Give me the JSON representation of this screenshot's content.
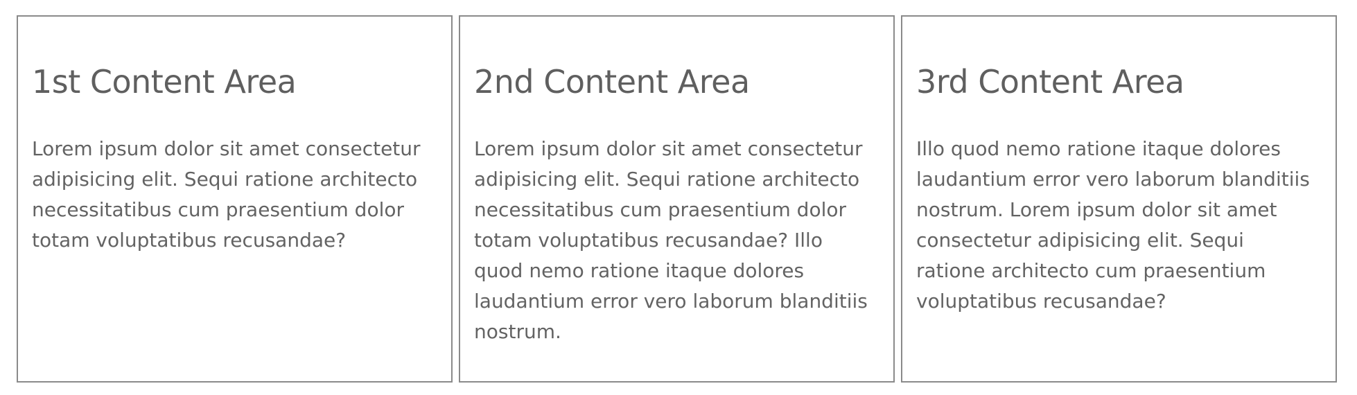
{
  "cards": [
    {
      "title": "1st Content Area",
      "body": "Lorem ipsum dolor sit amet consectetur adipisicing elit. Sequi ratione architecto necessitatibus cum praesentium dolor totam voluptatibus recusandae?"
    },
    {
      "title": "2nd Content Area",
      "body": "Lorem ipsum dolor sit amet consectetur adipisicing elit. Sequi ratione architecto necessitatibus cum praesentium dolor totam voluptatibus recusandae? Illo quod nemo ratione itaque dolores laudantium error vero laborum blanditiis nostrum."
    },
    {
      "title": "3rd Content Area",
      "body": "Illo quod nemo ratione itaque dolores laudantium error vero laborum blanditiis nostrum. Lorem ipsum dolor sit amet consectetur adipisicing elit. Sequi ratione architecto cum praesentium voluptatibus recusandae?"
    }
  ]
}
